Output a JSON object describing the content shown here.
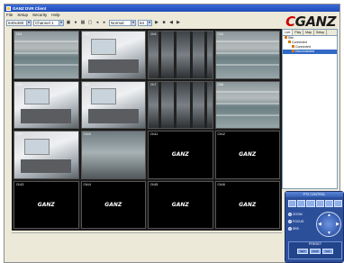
{
  "window": {
    "title": "GANZ DVR Client"
  },
  "menu": [
    "File",
    "Setup",
    "Security",
    "Help"
  ],
  "toolbar": {
    "resolution": "640x480",
    "channel": "Channel 1",
    "mode": "Normal",
    "count": "64"
  },
  "logo": {
    "text": "GANZ",
    "mark": "C"
  },
  "cells": [
    {
      "type": "cam",
      "scene": "floor",
      "label": "Ch1"
    },
    {
      "type": "cam",
      "scene": "room",
      "label": "Ch2"
    },
    {
      "type": "cam",
      "scene": "shelf",
      "label": "Ch3"
    },
    {
      "type": "cam",
      "scene": "floor",
      "label": "Ch4"
    },
    {
      "type": "cam",
      "scene": "room",
      "label": "Ch5"
    },
    {
      "type": "cam",
      "scene": "room",
      "label": "Ch6"
    },
    {
      "type": "cam",
      "scene": "shelf",
      "label": "Ch7"
    },
    {
      "type": "cam",
      "scene": "floor",
      "label": "Ch8"
    },
    {
      "type": "cam",
      "scene": "room",
      "label": "Ch9"
    },
    {
      "type": "cam",
      "scene": "out",
      "label": "Ch10"
    },
    {
      "type": "nosig",
      "label": "Ch11"
    },
    {
      "type": "nosig",
      "label": "Ch12"
    },
    {
      "type": "nosig",
      "label": "Ch13"
    },
    {
      "type": "nosig",
      "label": "Ch14"
    },
    {
      "type": "nosig",
      "label": "Ch15"
    },
    {
      "type": "nosig",
      "label": "Ch16"
    }
  ],
  "nosig_brand": "GANZ",
  "tree": {
    "tabs": [
      "Live",
      "Play",
      "Map",
      "Setup"
    ],
    "items": [
      {
        "label": "Site",
        "level": 0
      },
      {
        "label": "Connected",
        "level": 1
      },
      {
        "label": "Connected",
        "level": 2
      },
      {
        "label": "Disconnected",
        "level": 2,
        "selected": true
      }
    ]
  },
  "ptz": {
    "title": "PTZ CONTROL",
    "side": [
      "ZOOM",
      "FOCUS",
      "IRIS"
    ],
    "preset_label": "PRESET",
    "preset_buttons": [
      "SET",
      "CLR",
      "GO"
    ]
  }
}
